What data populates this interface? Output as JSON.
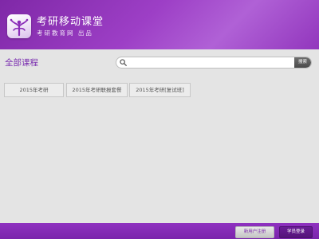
{
  "header": {
    "title": "考研移动课堂",
    "subtitle": "考研教育网 出品",
    "logo_icon": "tree-of-knowledge-icon"
  },
  "main": {
    "section_title": "全部课程",
    "search": {
      "placeholder": "",
      "value": "",
      "icon": "search-icon",
      "button_label": "搜索"
    },
    "course_tabs": [
      {
        "label": "2015年考研"
      },
      {
        "label": "2015年考研联报套餐"
      },
      {
        "label": "2015年考研[复试班]"
      }
    ]
  },
  "footer": {
    "register_label": "新用户注册",
    "login_label": "学员登录"
  },
  "colors": {
    "brand_purple": "#8e30bf",
    "title_purple": "#7b2fb0",
    "background": "#e4e4e4"
  }
}
